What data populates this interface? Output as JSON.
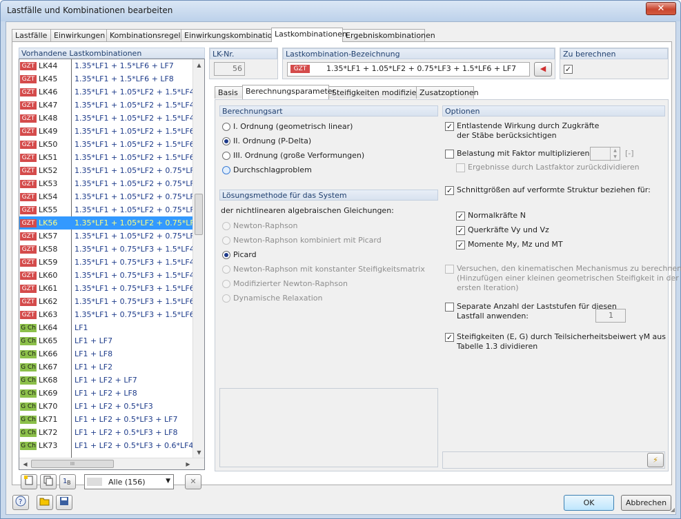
{
  "window": {
    "title": "Lastfälle und Kombinationen bearbeiten",
    "close": "✕"
  },
  "main_tabs": [
    "Lastfälle",
    "Einwirkungen",
    "Kombinationsregeln",
    "Einwirkungskombinationen",
    "Lastkombinationen",
    "Ergebniskombinationen"
  ],
  "list": {
    "header": "Vorhandene Lastkombinationen",
    "rows": [
      {
        "badge": "GZT",
        "lk": "LK44",
        "expr": "1.35*LF1 + 1.5*LF6 + LF7"
      },
      {
        "badge": "GZT",
        "lk": "LK45",
        "expr": "1.35*LF1 + 1.5*LF6 + LF8"
      },
      {
        "badge": "GZT",
        "lk": "LK46",
        "expr": "1.35*LF1 + 1.05*LF2 + 1.5*LF4"
      },
      {
        "badge": "GZT",
        "lk": "LK47",
        "expr": "1.35*LF1 + 1.05*LF2 + 1.5*LF4 + LF"
      },
      {
        "badge": "GZT",
        "lk": "LK48",
        "expr": "1.35*LF1 + 1.05*LF2 + 1.5*LF4 + LF"
      },
      {
        "badge": "GZT",
        "lk": "LK49",
        "expr": "1.35*LF1 + 1.05*LF2 + 1.5*LF6"
      },
      {
        "badge": "GZT",
        "lk": "LK50",
        "expr": "1.35*LF1 + 1.05*LF2 + 1.5*LF6 + LF"
      },
      {
        "badge": "GZT",
        "lk": "LK51",
        "expr": "1.35*LF1 + 1.05*LF2 + 1.5*LF6 + LF"
      },
      {
        "badge": "GZT",
        "lk": "LK52",
        "expr": "1.35*LF1 + 1.05*LF2 + 0.75*LF3 + 1"
      },
      {
        "badge": "GZT",
        "lk": "LK53",
        "expr": "1.35*LF1 + 1.05*LF2 + 0.75*LF3 + 1"
      },
      {
        "badge": "GZT",
        "lk": "LK54",
        "expr": "1.35*LF1 + 1.05*LF2 + 0.75*LF3 + 1"
      },
      {
        "badge": "GZT",
        "lk": "LK55",
        "expr": "1.35*LF1 + 1.05*LF2 + 0.75*LF3 + 1"
      },
      {
        "badge": "GZT",
        "lk": "LK56",
        "expr": "1.35*LF1 + 1.05*LF2 + 0.75*LF3 + 1"
      },
      {
        "badge": "GZT",
        "lk": "LK57",
        "expr": "1.35*LF1 + 1.05*LF2 + 0.75*LF3 + 1"
      },
      {
        "badge": "GZT",
        "lk": "LK58",
        "expr": "1.35*LF1 + 0.75*LF3 + 1.5*LF4"
      },
      {
        "badge": "GZT",
        "lk": "LK59",
        "expr": "1.35*LF1 + 0.75*LF3 + 1.5*LF4 + LF"
      },
      {
        "badge": "GZT",
        "lk": "LK60",
        "expr": "1.35*LF1 + 0.75*LF3 + 1.5*LF4 + LF"
      },
      {
        "badge": "GZT",
        "lk": "LK61",
        "expr": "1.35*LF1 + 0.75*LF3 + 1.5*LF6"
      },
      {
        "badge": "GZT",
        "lk": "LK62",
        "expr": "1.35*LF1 + 0.75*LF3 + 1.5*LF6 + LF"
      },
      {
        "badge": "GZT",
        "lk": "LK63",
        "expr": "1.35*LF1 + 0.75*LF3 + 1.5*LF6 + LF"
      },
      {
        "badge": "G Ch",
        "lk": "LK64",
        "expr": "LF1"
      },
      {
        "badge": "G Ch",
        "lk": "LK65",
        "expr": "LF1 + LF7"
      },
      {
        "badge": "G Ch",
        "lk": "LK66",
        "expr": "LF1 + LF8"
      },
      {
        "badge": "G Ch",
        "lk": "LK67",
        "expr": "LF1 + LF2"
      },
      {
        "badge": "G Ch",
        "lk": "LK68",
        "expr": "LF1 + LF2 + LF7"
      },
      {
        "badge": "G Ch",
        "lk": "LK69",
        "expr": "LF1 + LF2 + LF8"
      },
      {
        "badge": "G Ch",
        "lk": "LK70",
        "expr": "LF1 + LF2 + 0.5*LF3"
      },
      {
        "badge": "G Ch",
        "lk": "LK71",
        "expr": "LF1 + LF2 + 0.5*LF3 + LF7"
      },
      {
        "badge": "G Ch",
        "lk": "LK72",
        "expr": "LF1 + LF2 + 0.5*LF3 + LF8"
      },
      {
        "badge": "G Ch",
        "lk": "LK73",
        "expr": "LF1 + LF2 + 0.5*LF3 + 0.6*LF4"
      }
    ],
    "selected_index": 12,
    "hscroll_grip": "III",
    "filter": "Alle (156)"
  },
  "lk_nr": {
    "label": "LK-Nr.",
    "value": "56"
  },
  "bezeichnung": {
    "label": "Lastkombination-Bezeichnung",
    "badge": "GZT",
    "value": "1.35*LF1 + 1.05*LF2 + 0.75*LF3 + 1.5*LF6 + LF7"
  },
  "zu_berechnen": {
    "label": "Zu berechnen",
    "checked": "✓"
  },
  "sub_tabs": [
    "Basis",
    "Berechnungsparameter",
    "Steifigkeiten modifizieren",
    "Zusatzoptionen"
  ],
  "berechnungsart": {
    "header": "Berechnungsart",
    "options": [
      "I. Ordnung (geometrisch linear)",
      "II. Ordnung (P-Delta)",
      "III. Ordnung (große Verformungen)",
      "Durchschlagproblem"
    ]
  },
  "loesung": {
    "header": "Lösungsmethode für das System",
    "sublabel": "der nichtlinearen algebraischen Gleichungen:",
    "options": [
      "Newton-Raphson",
      "Newton-Raphson kombiniert mit Picard",
      "Picard",
      "Newton-Raphson mit konstanter Steifigkeitsmatrix",
      "Modifizierter Newton-Raphson",
      "Dynamische Relaxation"
    ]
  },
  "optionen": {
    "header": "Optionen",
    "entlastend_1": "Entlastende Wirkung durch Zugkräfte",
    "entlastend_2": "der Stäbe berücksichtigen",
    "faktor": "Belastung mit Faktor multiplizieren:",
    "faktor_unit": "[-]",
    "ergebnisse": "Ergebnisse durch Lastfaktor zurückdividieren",
    "schnitt": "Schnittgrößen auf verformte Struktur beziehen für:",
    "normal": "Normalkräfte N",
    "quer": "Querkräfte Vy und Vz",
    "momente": "Momente My, Mz und MT",
    "versuchen_1": "Versuchen, den kinematischen Mechanismus zu berechnen",
    "versuchen_2": "(Hinzufügen einer kleinen geometrischen Steifigkeit in der",
    "versuchen_3": "ersten Iteration)",
    "separate_1": "Separate Anzahl der Laststufen für diesen",
    "separate_2": "Lastfall anwenden:",
    "laststufen": "1",
    "steif_1": "Steifigkeiten (E, G) durch Teilsicherheitsbeiwert γM aus",
    "steif_2": "Tabelle 1.3 dividieren"
  },
  "buttons": {
    "ok": "OK",
    "cancel": "Abbrechen"
  },
  "colors": {
    "gzt": "#d44b4b",
    "gch": "#8cc04a",
    "selection": "#3399ff"
  }
}
